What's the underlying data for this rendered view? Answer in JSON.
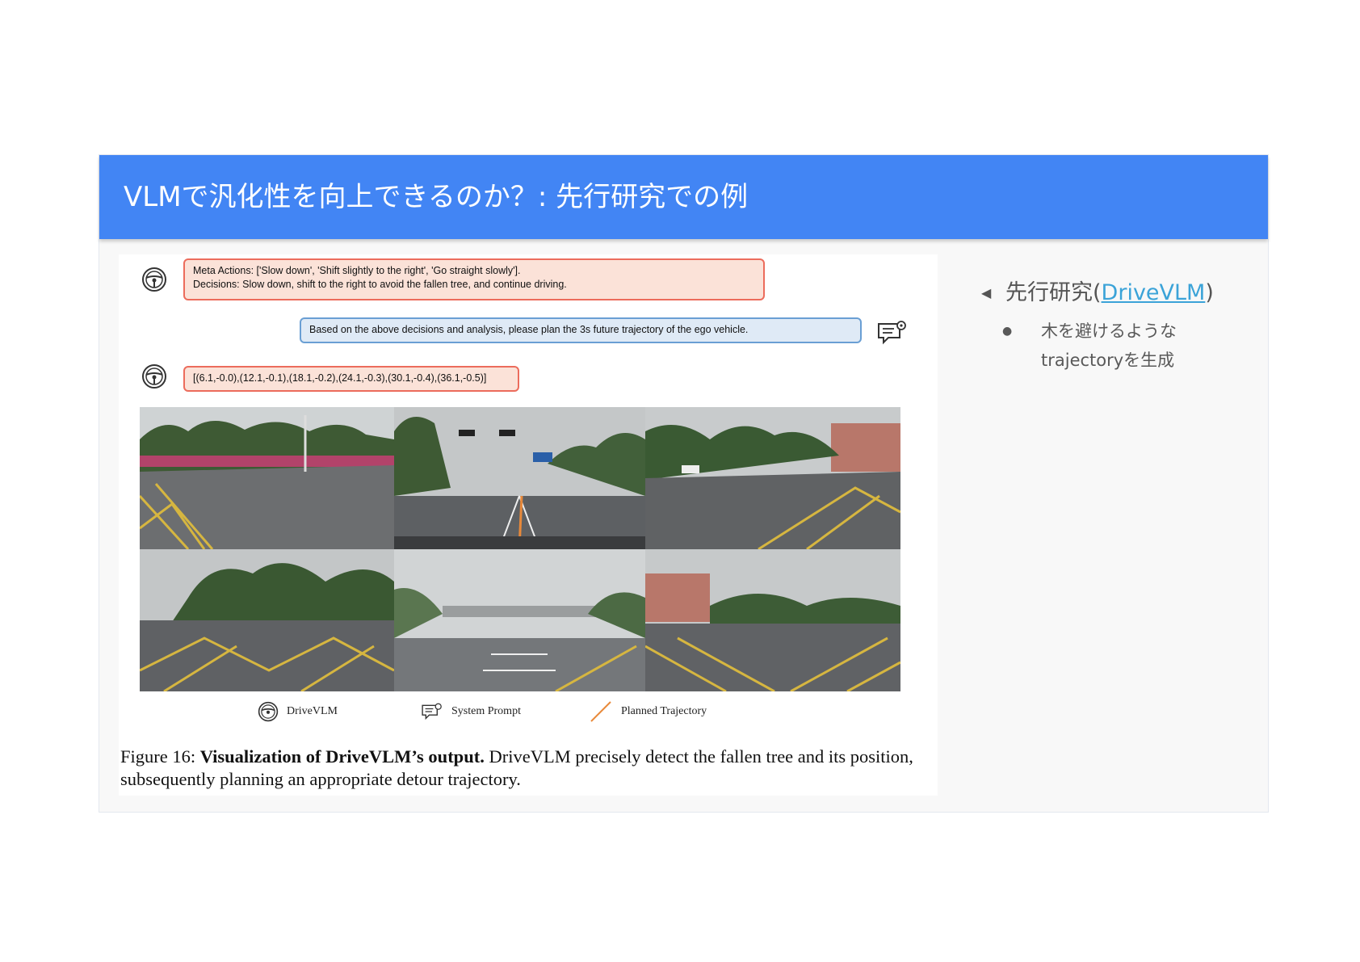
{
  "slide": {
    "title": "VLMで汎化性を向上できるのか？: 先行研究での例"
  },
  "figure": {
    "bubble1_line1": "Meta Actions: ['Slow down', 'Shift slightly to the right', 'Go straight slowly'].",
    "bubble1_line2": "Decisions: Slow down, shift to the right to avoid the fallen tree, and continue driving.",
    "prompt": "Based on the above decisions and analysis, please plan the 3s future trajectory of the ego vehicle.",
    "trajectory": "[(6.1,-0.0),(12.1,-0.1),(18.1,-0.2),(24.1,-0.3),(30.1,-0.4),(36.1,-0.5)]",
    "legend": {
      "drivevlm": "DriveVLM",
      "system_prompt": "System Prompt",
      "planned_trajectory": "Planned Trajectory"
    },
    "caption_label": "Figure 16:",
    "caption_bold": "Visualization of DriveVLM’s output.",
    "caption_rest": "DriveVLM precisely detect the fallen tree and its position, subsequently planning an appropriate detour trajectory."
  },
  "notes": {
    "main_prefix": "先行研究(",
    "main_link": "DriveVLM",
    "main_suffix": ")",
    "sub": "木を避けるような trajectoryを生成"
  },
  "colors": {
    "title_bar": "#4285f4",
    "link": "#3ba3d8",
    "trajectory": "#e8893a"
  },
  "icons": [
    "steering-wheel-icon",
    "chat-settings-icon",
    "trajectory-line-icon",
    "bullet-triangle-icon"
  ]
}
